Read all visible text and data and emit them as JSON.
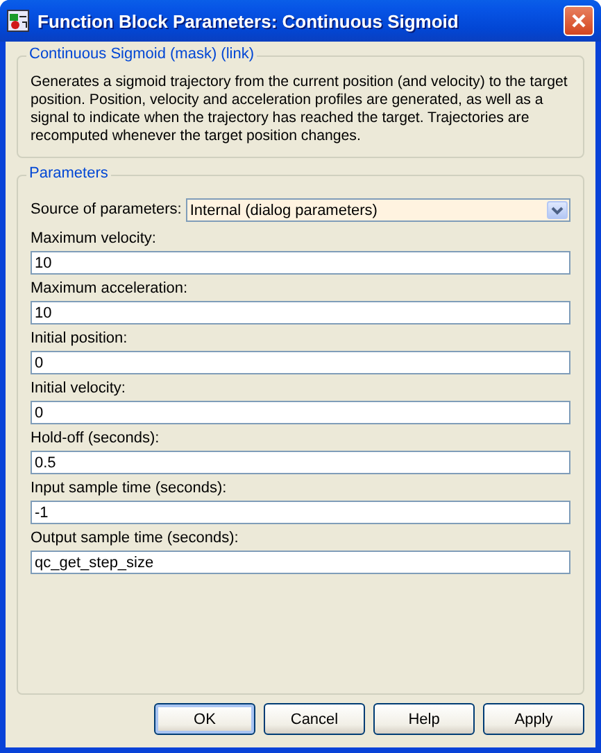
{
  "window": {
    "title": "Function Block Parameters: Continuous Sigmoid"
  },
  "description_group": {
    "title": "Continuous Sigmoid (mask) (link)",
    "text": "Generates a sigmoid trajectory from the current position (and velocity) to the target position. Position, velocity and acceleration profiles are generated, as well as a signal to indicate when the trajectory has reached the target. Trajectories are recomputed whenever the target position changes."
  },
  "parameters_group": {
    "title": "Parameters",
    "source": {
      "label": "Source of parameters:",
      "value": "Internal (dialog parameters)"
    },
    "fields": [
      {
        "label": "Maximum velocity:",
        "value": "10"
      },
      {
        "label": "Maximum acceleration:",
        "value": "10"
      },
      {
        "label": "Initial position:",
        "value": "0"
      },
      {
        "label": "Initial velocity:",
        "value": "0"
      },
      {
        "label": "Hold-off (seconds):",
        "value": "0.5"
      },
      {
        "label": "Input sample time (seconds):",
        "value": "-1"
      },
      {
        "label": "Output sample time (seconds):",
        "value": "qc_get_step_size"
      }
    ]
  },
  "buttons": [
    {
      "label": "OK",
      "focused": true
    },
    {
      "label": "Cancel",
      "focused": false
    },
    {
      "label": "Help",
      "focused": false
    },
    {
      "label": "Apply",
      "focused": false
    }
  ]
}
